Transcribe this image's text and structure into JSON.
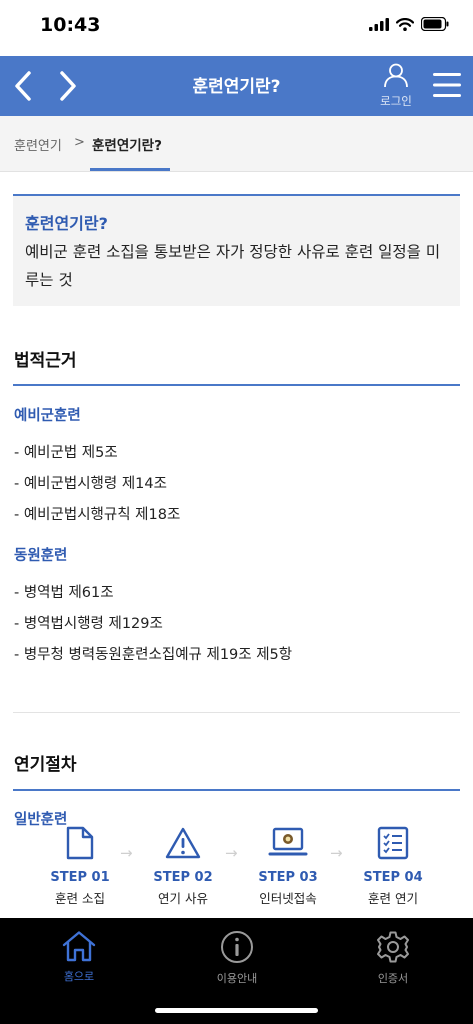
{
  "status": {
    "time": "10:43"
  },
  "topbar": {
    "title": "훈련연기란?",
    "login_label": "로그인"
  },
  "breadcrumb": {
    "parent": "훈련연기",
    "separator": ">",
    "current": "훈련연기란?"
  },
  "definition": {
    "title": "훈련연기란?",
    "text": "예비군 훈련 소집을 통보받은 자가 정당한 사유로 훈련 일정을 미루는 것"
  },
  "legal_basis": {
    "title": "법적근거",
    "groups": [
      {
        "title": "예비군훈련",
        "items": [
          "- 예비군법 제5조",
          "- 예비군법시행령 제14조",
          "- 예비군법시행규칙 제18조"
        ]
      },
      {
        "title": "동원훈련",
        "items": [
          "- 병역법 제61조",
          "- 병역법시행령 제129조",
          "- 병무청 병력동원훈련소집예규 제19조 제5항"
        ]
      }
    ]
  },
  "procedure": {
    "title": "연기절차",
    "subtitle": "일반훈련",
    "steps": [
      {
        "label": "STEP 01",
        "desc": "훈련 소집",
        "icon": "document-icon"
      },
      {
        "label": "STEP 02",
        "desc": "연기 사유",
        "icon": "warning-icon"
      },
      {
        "label": "STEP 03",
        "desc": "인터넷접속",
        "icon": "laptop-icon"
      },
      {
        "label": "STEP 04",
        "desc": "훈련 연기",
        "icon": "checklist-icon"
      }
    ],
    "arrow": "→"
  },
  "tabbar": {
    "items": [
      {
        "label": "홈으로",
        "icon": "home-icon",
        "active": true
      },
      {
        "label": "이용안내",
        "icon": "info-icon",
        "active": false
      },
      {
        "label": "인증서",
        "icon": "gear-icon",
        "active": false
      }
    ]
  },
  "colors": {
    "primary": "#4a78c8",
    "accent_text": "#2f5bb1",
    "tab_active": "#3f72d6"
  }
}
